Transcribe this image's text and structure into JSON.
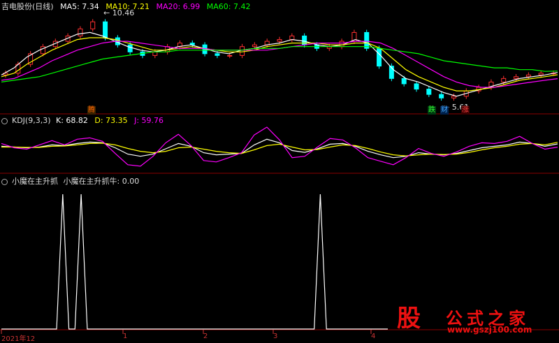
{
  "header": {
    "title": "吉电股份(日线)",
    "ma5": "MA5: 7.34",
    "ma10": "MA10: 7.21",
    "ma20": "MA20: 6.99",
    "ma60": "MA60: 7.42",
    "colors": {
      "ma5": "#ffffff",
      "ma10": "#ffff00",
      "ma20": "#ff00ff",
      "ma60": "#00ff00"
    }
  },
  "kdj_header": {
    "name": "KDJ(9,3,3)",
    "k": "K: 68.82",
    "d": "D: 73.35",
    "j": "J: 59.76"
  },
  "ind_header": {
    "name": "小魔在主升抓",
    "line": "小魔在主升抓牛: 0.00"
  },
  "annotations": {
    "high": "10.46",
    "low": "5.61",
    "sig1": "腾",
    "sig2": "跌",
    "sig3": "财",
    "sig4": "涨"
  },
  "x_ticks": [
    "2021年12",
    "1",
    "2",
    "3",
    "4"
  ],
  "logo": {
    "mark": "股",
    "name": "公式之家",
    "url": "www.gszj100.com"
  },
  "chart_data": [
    {
      "type": "candlestick",
      "title": "吉电股份(日线)",
      "series": [
        {
          "name": "MA5",
          "values": [
            7.2,
            7.6,
            8.2,
            8.6,
            8.9,
            9.2,
            9.5,
            9.6,
            9.4,
            9.1,
            8.8,
            8.6,
            8.5,
            8.6,
            8.8,
            8.9,
            8.7,
            8.5,
            8.4,
            8.6,
            8.7,
            8.9,
            9.0,
            9.2,
            9.1,
            8.9,
            8.8,
            8.9,
            9.2,
            9.0,
            8.3,
            7.5,
            7.0,
            6.8,
            6.5,
            6.2,
            6.0,
            6.2,
            6.4,
            6.6,
            6.8,
            7.0,
            7.1,
            7.2,
            7.34
          ]
        },
        {
          "name": "MA10",
          "values": [
            7.1,
            7.3,
            7.8,
            8.2,
            8.6,
            8.9,
            9.2,
            9.3,
            9.3,
            9.2,
            9.0,
            8.8,
            8.6,
            8.6,
            8.7,
            8.8,
            8.7,
            8.6,
            8.5,
            8.5,
            8.6,
            8.8,
            8.9,
            9.0,
            9.0,
            9.0,
            8.9,
            8.9,
            9.0,
            9.0,
            8.7,
            8.1,
            7.5,
            7.1,
            6.8,
            6.5,
            6.3,
            6.3,
            6.4,
            6.5,
            6.7,
            6.9,
            7.0,
            7.1,
            7.21
          ]
        },
        {
          "name": "MA20",
          "values": [
            6.9,
            7.0,
            7.3,
            7.6,
            8.0,
            8.3,
            8.6,
            8.8,
            9.0,
            9.1,
            9.1,
            9.0,
            8.9,
            8.8,
            8.7,
            8.7,
            8.7,
            8.6,
            8.6,
            8.6,
            8.6,
            8.6,
            8.7,
            8.8,
            8.9,
            9.0,
            9.0,
            9.0,
            9.1,
            9.1,
            9.0,
            8.7,
            8.3,
            7.9,
            7.5,
            7.1,
            6.8,
            6.6,
            6.5,
            6.5,
            6.6,
            6.7,
            6.8,
            6.9,
            6.99
          ]
        },
        {
          "name": "MA60",
          "values": [
            6.8,
            6.9,
            7.0,
            7.1,
            7.3,
            7.5,
            7.7,
            7.9,
            8.1,
            8.2,
            8.3,
            8.4,
            8.5,
            8.5,
            8.6,
            8.6,
            8.6,
            8.6,
            8.6,
            8.6,
            8.7,
            8.7,
            8.7,
            8.8,
            8.8,
            8.8,
            8.8,
            8.8,
            8.8,
            8.8,
            8.7,
            8.6,
            8.5,
            8.4,
            8.2,
            8.0,
            7.9,
            7.8,
            7.7,
            7.6,
            7.6,
            7.5,
            7.5,
            7.4,
            7.42
          ]
        }
      ],
      "close": [
        7.3,
        7.8,
        8.4,
        8.8,
        9.1,
        9.4,
        9.8,
        10.2,
        9.3,
        8.9,
        8.5,
        8.3,
        8.5,
        8.8,
        9.0,
        8.9,
        8.4,
        8.3,
        8.3,
        8.8,
        8.9,
        9.1,
        9.2,
        9.4,
        8.9,
        8.7,
        8.8,
        9.1,
        9.6,
        8.7,
        7.7,
        7.0,
        6.7,
        6.4,
        6.1,
        5.9,
        6.0,
        6.3,
        6.5,
        6.8,
        7.0,
        7.1,
        7.2,
        7.3,
        7.3
      ],
      "high_label": 10.46,
      "low_label": 5.61,
      "ylim": [
        5.2,
        10.8
      ]
    },
    {
      "type": "line",
      "title": "KDJ(9,3,3)",
      "series": [
        {
          "name": "K",
          "values": [
            62,
            60,
            58,
            60,
            66,
            64,
            70,
            74,
            72,
            58,
            40,
            34,
            40,
            55,
            70,
            62,
            44,
            38,
            40,
            42,
            66,
            82,
            72,
            50,
            45,
            55,
            68,
            70,
            62,
            48,
            38,
            30,
            34,
            44,
            40,
            38,
            42,
            50,
            58,
            62,
            66,
            74,
            70,
            62,
            68.82
          ]
        },
        {
          "name": "D",
          "values": [
            60,
            60,
            59,
            59,
            62,
            63,
            66,
            70,
            71,
            66,
            56,
            48,
            44,
            48,
            58,
            60,
            54,
            48,
            44,
            42,
            52,
            64,
            68,
            60,
            52,
            53,
            60,
            66,
            64,
            56,
            46,
            38,
            35,
            38,
            40,
            39,
            40,
            45,
            52,
            58,
            62,
            68,
            70,
            66,
            73.35
          ]
        },
        {
          "name": "J",
          "values": [
            70,
            58,
            54,
            66,
            78,
            66,
            82,
            86,
            76,
            42,
            10,
            6,
            34,
            72,
            96,
            64,
            22,
            18,
            30,
            44,
            94,
            116,
            80,
            30,
            34,
            60,
            84,
            80,
            58,
            30,
            20,
            10,
            30,
            56,
            42,
            34,
            46,
            62,
            72,
            70,
            76,
            90,
            70,
            54,
            59.76
          ]
        }
      ],
      "ylim": [
        -10,
        120
      ]
    },
    {
      "type": "line",
      "title": "小魔在主升抓",
      "series": [
        {
          "name": "小魔在主升抓牛",
          "values": [
            0,
            0,
            0,
            0,
            0,
            0,
            0,
            0,
            0,
            0,
            1,
            0,
            0,
            1,
            0,
            0,
            0,
            0,
            0,
            0,
            0,
            0,
            0,
            0,
            0,
            0,
            0,
            0,
            0,
            0,
            0,
            0,
            0,
            0,
            0,
            0,
            0,
            0,
            0,
            0,
            0,
            0,
            0,
            0,
            0,
            0,
            0,
            0,
            0,
            0,
            0,
            0,
            1,
            0,
            0,
            0,
            0,
            0,
            0,
            0,
            0,
            0,
            0,
            0
          ]
        }
      ],
      "ylim": [
        0,
        1
      ]
    }
  ]
}
